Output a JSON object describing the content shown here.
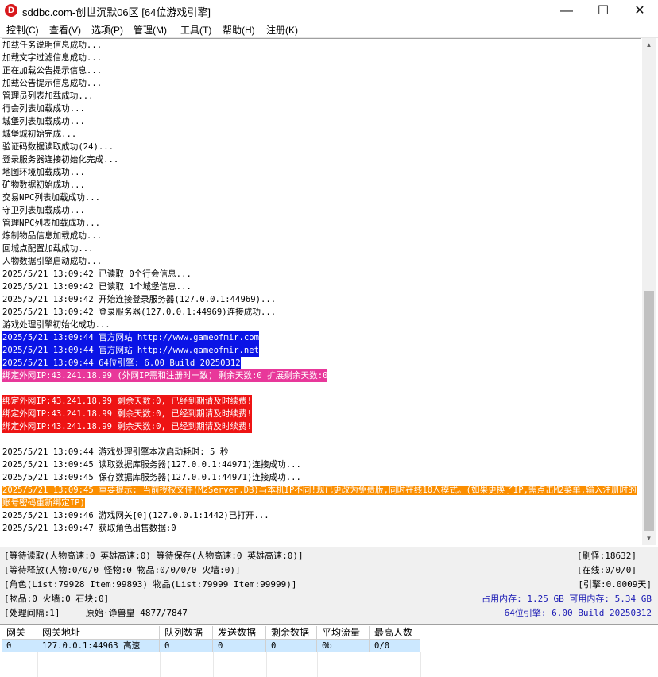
{
  "window": {
    "title": "sddbc.com-创世沉默06区 [64位游戏引擎]",
    "app_icon_glyph": "D",
    "minimize": "—",
    "maximize": "☐",
    "close": "✕"
  },
  "menu": [
    "控制(C)",
    "查看(V)",
    "选项(P)",
    "管理(M)",
    "工具(T)",
    "帮助(H)",
    "注册(K)"
  ],
  "log": {
    "lines": [
      "加载任务说明信息成功...",
      "加载文字过滤信息成功...",
      "正在加载公告提示信息...",
      "加载公告提示信息成功...",
      "管理员列表加载成功...",
      "行会列表加载成功...",
      "城堡列表加载成功...",
      "城堡城初始完成...",
      "验证码数据读取成功(24)...",
      "登录服务器连接初始化完成...",
      "地图环境加载成功...",
      "矿物数据初始成功...",
      "交易NPC列表加载成功...",
      "守卫列表加载成功...",
      "管理NPC列表加载成功...",
      "炼制物品信息加载成功...",
      "回城点配置加载成功...",
      "人物数据引擎启动成功...",
      "2025/5/21 13:09:42 已读取 0个行会信息...",
      "2025/5/21 13:09:42 已读取 1个城堡信息...",
      "2025/5/21 13:09:42 开始连接登录服务器(127.0.0.1:44969)...",
      "2025/5/21 13:09:42 登录服务器(127.0.0.1:44969)连接成功...",
      "游戏处理引擎初始化成功..."
    ],
    "blue": [
      "2025/5/21 13:09:44 官方网站 http://www.gameofmir.com",
      "2025/5/21 13:09:44 官方网站 http://www.gameofmir.net",
      "2025/5/21 13:09:44 64位引擎: 6.00 Build 20250312"
    ],
    "pink": "绑定外网IP:43.241.18.99 (外网IP需和注册时一致) 剩余天数:0 扩展剩余天数:0",
    "red": [
      "绑定外网IP:43.241.18.99 剩余天数:0, 已经到期请及时续费!",
      "绑定外网IP:43.241.18.99 剩余天数:0, 已经到期请及时续费!",
      "绑定外网IP:43.241.18.99 剩余天数:0, 已经到期请及时续费!"
    ],
    "after": [
      "2025/5/21 13:09:44 游戏处理引擎本次启动耗时: 5 秒",
      "2025/5/21 13:09:45 读取数据库服务器(127.0.0.1:44971)连接成功...",
      "2025/5/21 13:09:45 保存数据库服务器(127.0.0.1:44971)连接成功..."
    ],
    "orange": "2025/5/21 13:09:45 重要提示: 当前授权文件(M2Server.DB)与本机IP不同!现已更改为免费版,同时在线10人模式。(如果更换了IP,需点击M2菜单,输入注册时的账号密码重新绑定IP)",
    "tail": [
      "2025/5/21 13:09:46 游戏网关[0](127.0.0.1:1442)已打开...",
      "2025/5/21 13:09:47 获取角色出售数据:0"
    ]
  },
  "status": {
    "line1": "[等待读取(人物高速:0 英雄高速:0) 等待保存(人物高速:0 英雄高速:0)]",
    "line2": "[等待释放(人物:0/0/0 怪物:0 物品:0/0/0/0 火墙:0)]",
    "line3": "[角色(List:79928 Item:99893) 物品(List:79999 Item:99999)]",
    "line4": "[物品:0 火墙:0 石块:0]",
    "line5a": "[处理间隔:1]",
    "line5b": "原始·诤兽皇 4877/7847",
    "r1": "[刷怪:18632]",
    "r2": "[在线:0/0/0]",
    "r3": "[引擎:0.0009天]",
    "r4": "占用内存: 1.25 GB 可用内存: 5.34 GB",
    "r5": "64位引擎: 6.00 Build 20250312"
  },
  "gateway_table": {
    "headers": [
      "网关",
      "网关地址",
      "队列数据",
      "发送数据",
      "剩余数据",
      "平均流量",
      "最高人数"
    ],
    "rows": [
      [
        "0",
        "127.0.0.1:44963 高速",
        "0",
        "0",
        "0",
        "0b",
        "0/0"
      ]
    ]
  },
  "colors": {
    "blue_highlight": "#0a14e6",
    "pink_highlight": "#e8389a",
    "red_highlight": "#ee1414",
    "orange_highlight": "#fb8e00",
    "selected_row": "#cce8ff"
  }
}
